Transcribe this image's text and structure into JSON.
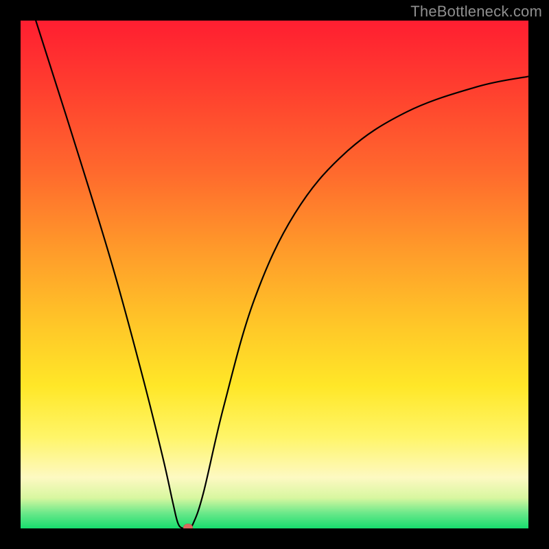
{
  "watermark": "TheBottleneck.com",
  "chart_data": {
    "type": "line",
    "title": "",
    "xlabel": "",
    "ylabel": "",
    "xlim": [
      0,
      100
    ],
    "ylim": [
      0,
      100
    ],
    "grid": false,
    "legend": false,
    "series": [
      {
        "name": "bottleneck-curve",
        "x": [
          3,
          10,
          18,
          24,
          28,
          30,
          31,
          32,
          33,
          34,
          36,
          40,
          46,
          54,
          64,
          76,
          90,
          100
        ],
        "values": [
          100,
          78,
          52,
          30,
          14,
          5,
          1,
          0,
          0,
          1,
          7,
          24,
          45,
          62,
          74,
          82,
          87,
          89
        ]
      }
    ],
    "marker": {
      "x": 33,
      "y": 0,
      "color": "#d96a5f"
    },
    "background_gradient": {
      "stops": [
        {
          "pos": 0,
          "color": "#ff1e31"
        },
        {
          "pos": 30,
          "color": "#ff6a2d"
        },
        {
          "pos": 60,
          "color": "#ffc728"
        },
        {
          "pos": 82,
          "color": "#fff568"
        },
        {
          "pos": 94,
          "color": "#d8f7a0"
        },
        {
          "pos": 100,
          "color": "#17dd6e"
        }
      ]
    }
  }
}
